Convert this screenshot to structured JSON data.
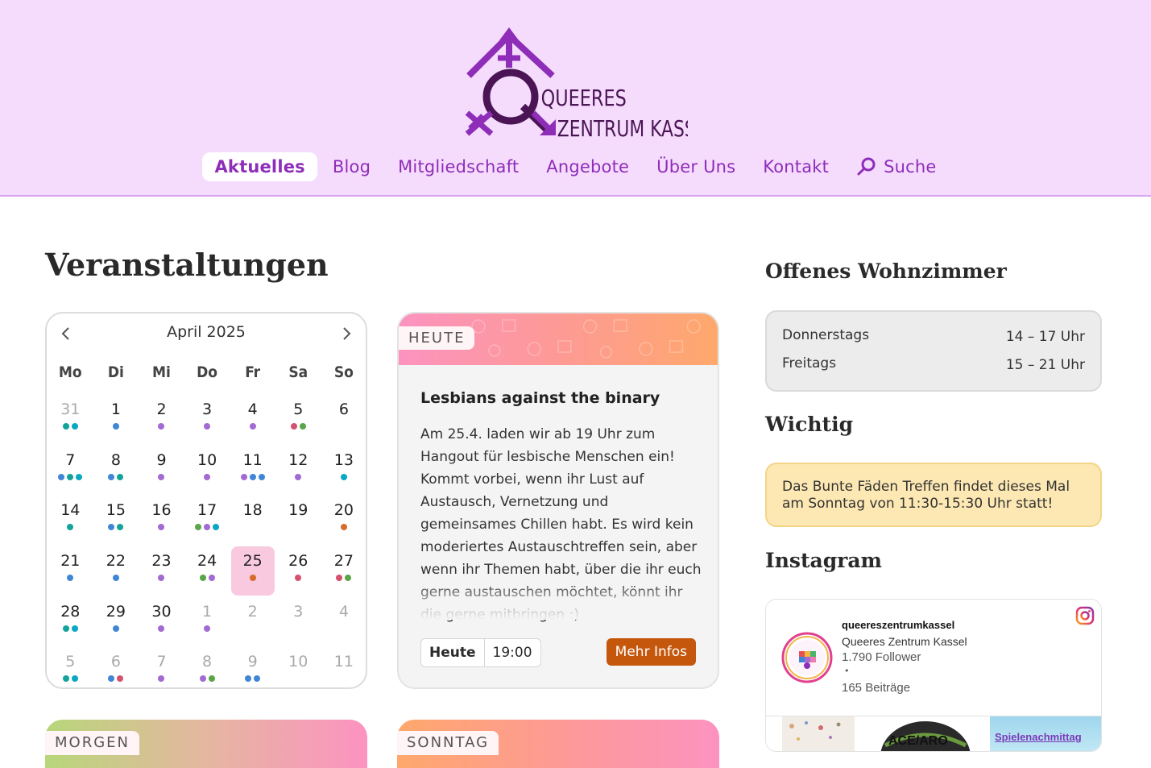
{
  "logo": {
    "text_line1": "QUEERES",
    "text_line2": "ZENTRUM KASSEL",
    "color": "#8e2db8"
  },
  "nav": {
    "items": [
      {
        "label": "Aktuelles",
        "active": true
      },
      {
        "label": "Blog"
      },
      {
        "label": "Mitgliedschaft"
      },
      {
        "label": "Angebote"
      },
      {
        "label": "Über Uns"
      },
      {
        "label": "Kontakt"
      }
    ],
    "search_label": "Suche",
    "search_icon": "search-icon"
  },
  "main": {
    "title": "Veranstaltungen"
  },
  "calendar": {
    "month": "April 2025",
    "prev_icon": "chevron-left-icon",
    "next_icon": "chevron-right-icon",
    "weekdays": [
      "Mo",
      "Di",
      "Mi",
      "Do",
      "Fr",
      "Sa",
      "So"
    ],
    "dot_colors": {
      "teal": "#13a39a",
      "blue": "#3f86d6",
      "purple": "#a26ad2",
      "pink": "#d5516f",
      "green": "#5aa547",
      "cyan": "#0aa7c4",
      "orange": "#d56c2a"
    },
    "days": [
      {
        "n": "31",
        "muted": true,
        "dots": [
          "teal",
          "cyan"
        ]
      },
      {
        "n": "1",
        "dots": [
          "blue"
        ]
      },
      {
        "n": "2",
        "dots": [
          "purple"
        ]
      },
      {
        "n": "3",
        "dots": [
          "purple"
        ]
      },
      {
        "n": "4",
        "dots": [
          "purple"
        ]
      },
      {
        "n": "5",
        "dots": [
          "pink",
          "green"
        ]
      },
      {
        "n": "6",
        "dots": []
      },
      {
        "n": "7",
        "dots": [
          "blue",
          "teal",
          "cyan"
        ]
      },
      {
        "n": "8",
        "dots": [
          "blue",
          "teal"
        ]
      },
      {
        "n": "9",
        "dots": [
          "purple"
        ]
      },
      {
        "n": "10",
        "dots": [
          "purple"
        ]
      },
      {
        "n": "11",
        "dots": [
          "purple",
          "blue",
          "blue"
        ]
      },
      {
        "n": "12",
        "dots": [
          "purple"
        ]
      },
      {
        "n": "13",
        "dots": [
          "cyan"
        ]
      },
      {
        "n": "14",
        "dots": [
          "teal"
        ]
      },
      {
        "n": "15",
        "dots": [
          "blue",
          "teal"
        ]
      },
      {
        "n": "16",
        "dots": [
          "purple"
        ]
      },
      {
        "n": "17",
        "dots": [
          "green",
          "purple",
          "cyan"
        ]
      },
      {
        "n": "18",
        "dots": []
      },
      {
        "n": "19",
        "dots": []
      },
      {
        "n": "20",
        "dots": [
          "orange"
        ]
      },
      {
        "n": "21",
        "dots": [
          "blue"
        ]
      },
      {
        "n": "22",
        "dots": [
          "blue"
        ]
      },
      {
        "n": "23",
        "dots": [
          "purple"
        ]
      },
      {
        "n": "24",
        "dots": [
          "green",
          "purple"
        ]
      },
      {
        "n": "25",
        "today": true,
        "dots": [
          "orange"
        ]
      },
      {
        "n": "26",
        "dots": [
          "pink"
        ]
      },
      {
        "n": "27",
        "dots": [
          "pink",
          "green"
        ]
      },
      {
        "n": "28",
        "dots": [
          "teal",
          "cyan"
        ]
      },
      {
        "n": "29",
        "dots": [
          "blue"
        ]
      },
      {
        "n": "30",
        "dots": [
          "purple"
        ]
      },
      {
        "n": "1",
        "muted": true,
        "dots": [
          "purple"
        ]
      },
      {
        "n": "2",
        "muted": true,
        "dots": []
      },
      {
        "n": "3",
        "muted": true,
        "dots": []
      },
      {
        "n": "4",
        "muted": true,
        "dots": []
      },
      {
        "n": "5",
        "muted": true,
        "dots": [
          "teal",
          "cyan"
        ]
      },
      {
        "n": "6",
        "muted": true,
        "dots": [
          "blue",
          "pink"
        ]
      },
      {
        "n": "7",
        "muted": true,
        "dots": [
          "purple"
        ]
      },
      {
        "n": "8",
        "muted": true,
        "dots": [
          "purple",
          "green"
        ]
      },
      {
        "n": "9",
        "muted": true,
        "dots": [
          "blue",
          "blue"
        ]
      },
      {
        "n": "10",
        "muted": true,
        "dots": []
      },
      {
        "n": "11",
        "muted": true,
        "dots": []
      }
    ]
  },
  "event_card": {
    "tag": "HEUTE",
    "title": "Lesbians against the binary",
    "text": "Am 25.4. laden wir ab 19 Uhr zum Hangout für lesbische Menschen ein! Kommt vorbei, wenn ihr Lust auf Austausch, Vernetzung und gemeinsames Chillen habt. Es wird kein moderiertes Austauschtreffen sein, aber wenn ihr Themen habt, über die ihr euch gerne austauschen möchtet, könnt ihr die gerne mitbringen :)",
    "day": "Heute",
    "time": "19:00",
    "button": "Mehr Infos",
    "button_color": "#c5570d"
  },
  "next_cards": [
    {
      "tag": "MORGEN"
    },
    {
      "tag": "SONNTAG"
    }
  ],
  "sidebar": {
    "wohnzimmer": {
      "title": "Offenes Wohnzimmer",
      "rows": [
        {
          "day": "Donnerstags",
          "time": "14 – 17 Uhr"
        },
        {
          "day": "Freitags",
          "time": "15 – 21 Uhr"
        }
      ]
    },
    "wichtig": {
      "title": "Wichtig",
      "text": "Das Bunte Fäden Treffen findet dieses Mal am Sonntag von 11:30-15:30 Uhr statt!"
    },
    "instagram": {
      "title": "Instagram",
      "username": "queereszentrumkassel",
      "name": "Queeres Zentrum Kassel",
      "followers": "1.790 Follower",
      "bullet": "•",
      "posts": "165 Beiträge",
      "thumb_labels": [
        "ACE/ARO",
        "Spielenachmittag"
      ],
      "icon": "instagram-icon"
    }
  }
}
